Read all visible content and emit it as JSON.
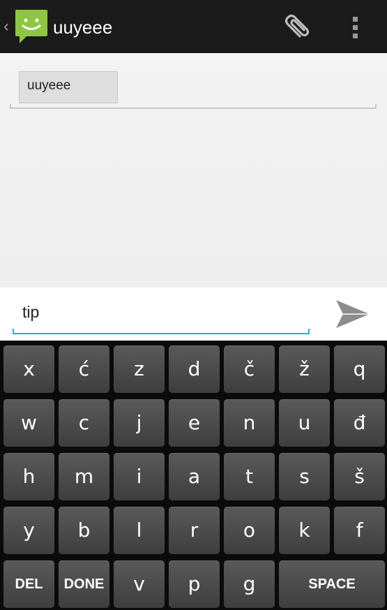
{
  "actionbar": {
    "title": "uuyeee",
    "back_glyph": "‹",
    "icons": {
      "app": "messaging-smiley-icon",
      "attach": "paperclip-icon",
      "menu": "overflow-menu-icon"
    },
    "colors": {
      "background": "#1b1b1b",
      "app_icon": "#8fc641"
    }
  },
  "recipients": [
    {
      "label": "uuyeee"
    }
  ],
  "composer": {
    "text": "tip",
    "send_icon": "send-icon",
    "accent": "#33a9d9"
  },
  "keyboard": {
    "rows": [
      [
        "x",
        "ć",
        "z",
        "d",
        "č",
        "ž",
        "q"
      ],
      [
        "w",
        "c",
        "j",
        "e",
        "n",
        "u",
        "đ"
      ],
      [
        "h",
        "m",
        "i",
        "a",
        "t",
        "s",
        "š"
      ],
      [
        "y",
        "b",
        "l",
        "r",
        "o",
        "k",
        "f"
      ],
      [
        "DEL",
        "DONE",
        "v",
        "p",
        "g",
        "SPACE"
      ]
    ]
  }
}
